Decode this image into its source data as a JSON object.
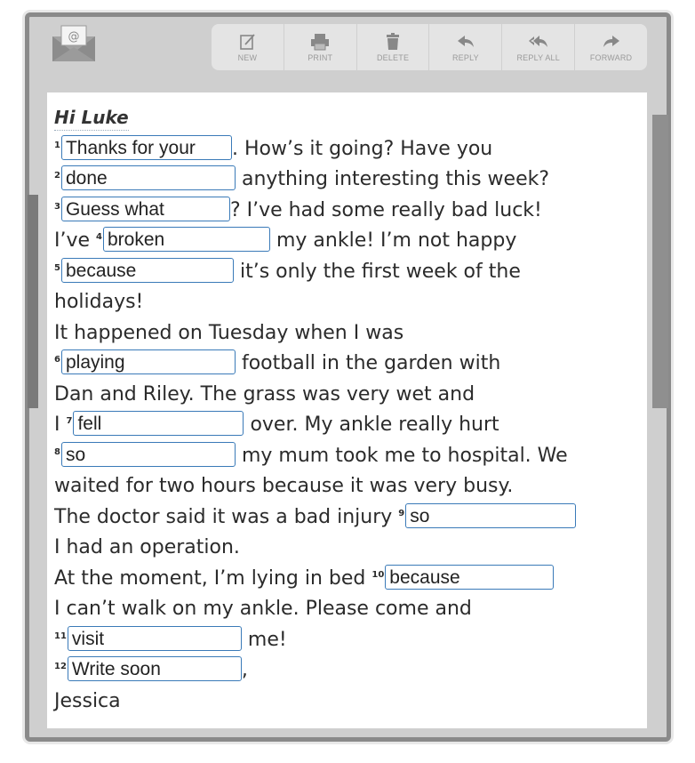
{
  "toolbar": {
    "new": "NEW",
    "print": "PRINT",
    "delete": "DELETE",
    "reply": "REPLY",
    "reply_all": "REPLY ALL",
    "forward": "FORWARD"
  },
  "icons": [
    "mail-icon",
    "new-icon",
    "print-icon",
    "delete-icon",
    "reply-icon",
    "reply-all-icon",
    "forward-icon"
  ],
  "letter": {
    "greeting": "Hi Luke",
    "t1": ". How’s it going? Have you",
    "t2": " anything interesting this week?",
    "t3": "? I’ve had some really bad luck!",
    "t4a": "I’ve ",
    "t4b": " my ankle! I’m not happy",
    "t5": " it’s only the first week of the",
    "t6": "holidays!",
    "t7": "It happened on Tuesday when I was",
    "t8": " football in the garden with",
    "t9": "Dan and Riley. The grass was very wet and",
    "t10a": "I ",
    "t10b": " over. My ankle really hurt",
    "t11": " my mum took me to hospital. We",
    "t12": "waited for two hours because it was very busy.",
    "t13": "The doctor said it was a bad injury ",
    "t14": "I had an operation.",
    "t15": "At the moment, I’m lying in bed ",
    "t16": "I can’t walk on my ankle. Please come and",
    "t17": " me!",
    "t18": ",",
    "signature": "Jessica"
  },
  "answers": [
    {
      "num": "1",
      "value": "Thanks for your"
    },
    {
      "num": "2",
      "value": "done"
    },
    {
      "num": "3",
      "value": "Guess what"
    },
    {
      "num": "4",
      "value": "broken"
    },
    {
      "num": "5",
      "value": "because"
    },
    {
      "num": "6",
      "value": "playing"
    },
    {
      "num": "7",
      "value": "fell"
    },
    {
      "num": "8",
      "value": "so"
    },
    {
      "num": "9",
      "value": "so"
    },
    {
      "num": "10",
      "value": "because"
    },
    {
      "num": "11",
      "value": "visit"
    },
    {
      "num": "12",
      "value": "Write soon"
    }
  ]
}
